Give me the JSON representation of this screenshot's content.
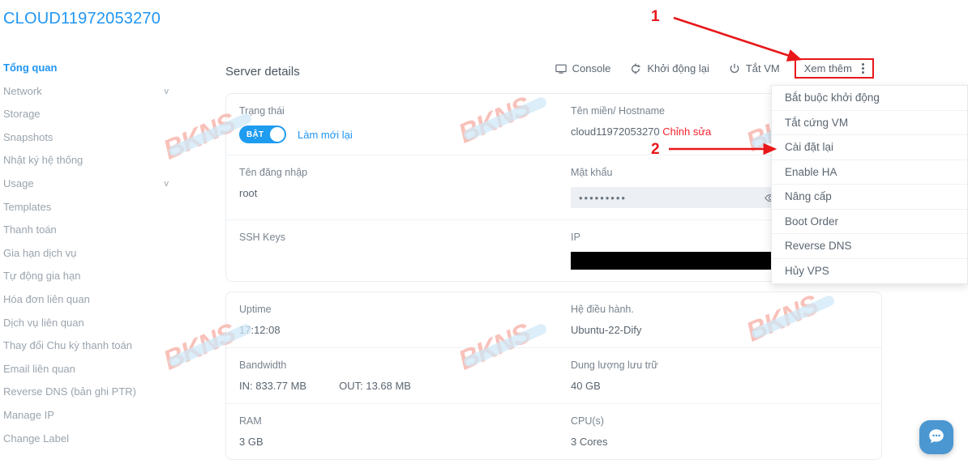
{
  "page": {
    "title": "CLOUD11972053270"
  },
  "sidebar": {
    "items": [
      {
        "label": "Tổng quan",
        "caret": "",
        "active": true
      },
      {
        "label": "Network",
        "caret": "v",
        "active": false
      },
      {
        "label": "Storage",
        "caret": "",
        "active": false
      },
      {
        "label": "Snapshots",
        "caret": "",
        "active": false
      },
      {
        "label": "Nhật ký hệ thống",
        "caret": "",
        "active": false
      },
      {
        "label": "Usage",
        "caret": "v",
        "active": false
      },
      {
        "label": "Templates",
        "caret": "",
        "active": false
      },
      {
        "label": "Thanh toán",
        "caret": "",
        "active": false
      },
      {
        "label": "Gia hạn dịch vụ",
        "caret": "",
        "active": false
      },
      {
        "label": "Tự động gia hạn",
        "caret": "",
        "active": false
      },
      {
        "label": "Hóa đơn liên quan",
        "caret": "",
        "active": false
      },
      {
        "label": "Dịch vụ liên quan",
        "caret": "",
        "active": false
      },
      {
        "label": "Thay đổi Chu kỳ thanh toán",
        "caret": "",
        "active": false
      },
      {
        "label": "Email liên quan",
        "caret": "",
        "active": false
      },
      {
        "label": "Reverse DNS (bản ghi PTR)",
        "caret": "",
        "active": false
      },
      {
        "label": "Manage IP",
        "caret": "",
        "active": false
      },
      {
        "label": "Change Label",
        "caret": "",
        "active": false
      }
    ]
  },
  "toolbar": {
    "panel_title": "Server details",
    "console_label": "Console",
    "restart_label": "Khởi động lại",
    "shutdown_label": "Tắt VM",
    "more_label": "Xem thêm"
  },
  "details": {
    "status_label": "Trạng thái",
    "status_toggle_text": "BẬT",
    "refresh_label": "Làm mới lại",
    "hostname_label": "Tên miền/ Hostname",
    "hostname_value": "cloud11972053270",
    "hostname_edit_label": "Chỉnh sửa",
    "username_label": "Tên đăng nhập",
    "username_value": "root",
    "password_label": "Mật khẩu",
    "password_value": "•••••••••",
    "sshkeys_label": "SSH Keys",
    "sshkeys_value": "",
    "ip_label": "IP",
    "ip_value": "",
    "uptime_label": "Uptime",
    "uptime_value": "17:12:08",
    "os_label": "Hệ điều hành.",
    "os_value": "Ubuntu-22-Dify",
    "bandwidth_label": "Bandwidth",
    "bandwidth_in": "IN: 833.77 MB",
    "bandwidth_out": "OUT: 13.68 MB",
    "storage_label": "Dung lượng lưu trữ",
    "storage_value": "40 GB",
    "ram_label": "RAM",
    "ram_value": "3 GB",
    "cpu_label": "CPU(s)",
    "cpu_value": "3 Cores"
  },
  "more_menu": {
    "items": [
      {
        "label": "Bắt buộc khởi động"
      },
      {
        "label": "Tắt cứng VM"
      },
      {
        "label": "Cài đặt lại"
      },
      {
        "label": "Enable HA"
      },
      {
        "label": "Nâng cấp"
      },
      {
        "label": "Boot Order"
      },
      {
        "label": "Reverse DNS"
      },
      {
        "label": "Hủy VPS"
      }
    ]
  },
  "annotations": {
    "step1": "1",
    "step2": "2"
  },
  "watermarks": [
    {
      "text": "BKNS"
    },
    {
      "text": "BKNS"
    },
    {
      "text": "BKNS"
    },
    {
      "text": "BKNS"
    },
    {
      "text": "BKNS"
    },
    {
      "text": "BKNS"
    }
  ],
  "colors": {
    "accent_blue": "#2196f3",
    "annotation_red": "#e8171a",
    "edit_red": "#f5222d",
    "toggle_on": "#1e9cf0",
    "chat_blue": "#4a97d2"
  }
}
